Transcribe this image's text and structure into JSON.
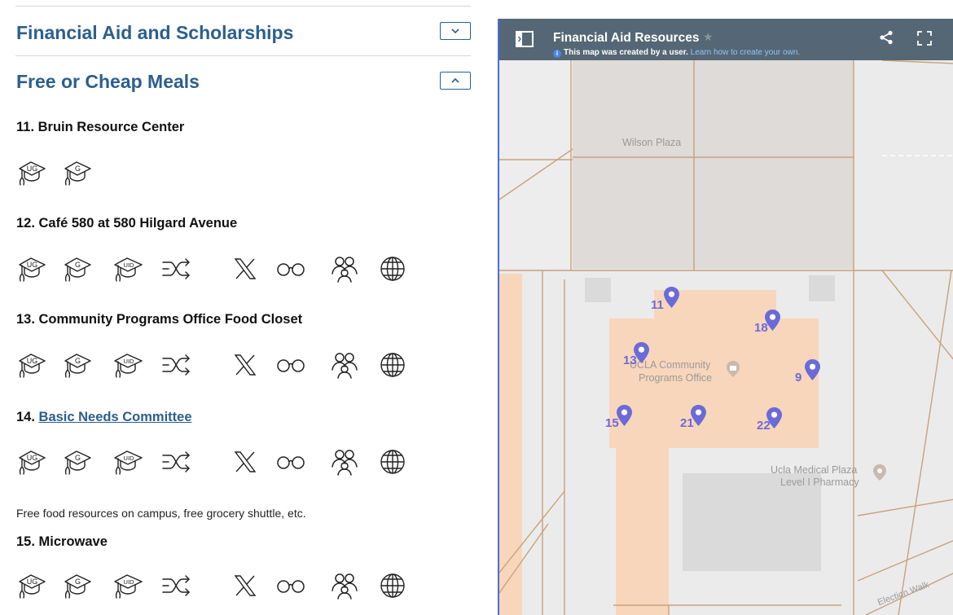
{
  "sections": {
    "financial_aid": {
      "title": "Financial Aid and Scholarships",
      "toggle_icon": "chevron-down-icon"
    },
    "meals": {
      "title": "Free or Cheap Meals",
      "toggle_icon": "chevron-up-icon"
    }
  },
  "items": [
    {
      "title": "11. Bruin Resource Center",
      "icons": [
        "undergraduate-icon",
        "graduate-icon"
      ]
    },
    {
      "title": "12. Café 580 at 580 Hilgard Avenue",
      "icons": [
        "undergraduate-icon",
        "graduate-icon",
        "undocumented-icon",
        "shuffle-icon",
        "x-icon",
        "glasses-icon",
        "people-icon",
        "globe-icon"
      ]
    },
    {
      "title": "13. Community Programs Office Food Closet",
      "icons": [
        "undergraduate-icon",
        "graduate-icon",
        "undocumented-icon",
        "shuffle-icon",
        "x-icon",
        "glasses-icon",
        "people-icon",
        "globe-icon"
      ]
    },
    {
      "title_prefix": "14. ",
      "link_text": "Basic Needs Committee",
      "icons": [
        "undergraduate-icon",
        "graduate-icon",
        "undocumented-icon",
        "shuffle-icon",
        "x-icon",
        "glasses-icon",
        "people-icon",
        "globe-icon"
      ],
      "description": "Free food resources on campus, free grocery shuttle, etc."
    },
    {
      "title": "15. Microwave",
      "icons": [
        "undergraduate-icon",
        "graduate-icon",
        "undocumented-icon",
        "shuffle-icon",
        "x-icon",
        "glasses-icon",
        "people-icon",
        "globe-icon"
      ]
    }
  ],
  "icon_text": {
    "ug": "UG",
    "g": "G",
    "uid": "UID"
  },
  "map": {
    "title": "Financial Aid Resources",
    "subtitle": "This map was created by a user.",
    "subtitle_link": "Learn how to create your own.",
    "info_glyph": "i",
    "star_glyph": "★",
    "labels": {
      "wilson": "Wilson Plaza",
      "cpo_line1": "UCLA Community",
      "cpo_line2": "Programs Office",
      "pharmacy_line1": "Ucla Medical Plaza",
      "pharmacy_line2": "Level I Pharmacy",
      "election": "Election Walk"
    },
    "markers": [
      "11",
      "18",
      "13",
      "9",
      "15",
      "21",
      "22"
    ],
    "colors": {
      "header": "#556774",
      "marker": "#6b6ad9",
      "building": "#f8d6bb",
      "road": "#c9a27c",
      "accent": "#2b5f8e"
    }
  }
}
